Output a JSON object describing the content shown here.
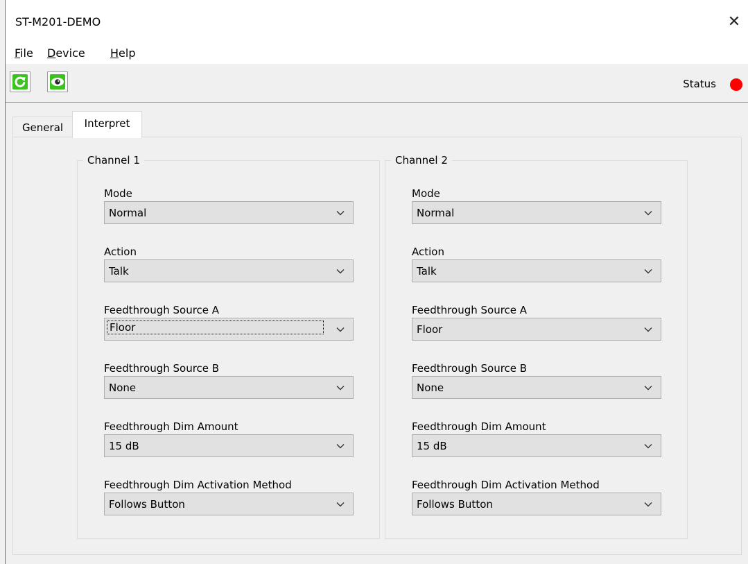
{
  "window": {
    "title": "ST-M201-DEMO",
    "close_glyph": "✕"
  },
  "menu": [
    {
      "accel": "F",
      "rest": "ile"
    },
    {
      "accel": "D",
      "rest": "evice"
    },
    {
      "accel": "H",
      "rest": "elp"
    }
  ],
  "toolbar": {
    "refresh_icon": "refresh-icon",
    "monitor_icon": "eye-icon",
    "status_label": "Status",
    "status_color": "#ff0000"
  },
  "tabs": [
    {
      "label": "General",
      "active": false
    },
    {
      "label": "Interpret",
      "active": true
    }
  ],
  "channels": [
    {
      "title": "Channel 1",
      "fields": [
        {
          "label": "Mode",
          "value": "Normal"
        },
        {
          "label": "Action",
          "value": "Talk"
        },
        {
          "label": "Feedthrough Source A",
          "value": "Floor"
        },
        {
          "label": "Feedthrough Source B",
          "value": "None"
        },
        {
          "label": "Feedthrough Dim Amount",
          "value": "15 dB"
        },
        {
          "label": "Feedthrough Dim Activation Method",
          "value": "Follows Button"
        }
      ]
    },
    {
      "title": "Channel 2",
      "fields": [
        {
          "label": "Mode",
          "value": "Normal"
        },
        {
          "label": "Action",
          "value": "Talk"
        },
        {
          "label": "Feedthrough Source A",
          "value": "Floor"
        },
        {
          "label": "Feedthrough Source B",
          "value": "None"
        },
        {
          "label": "Feedthrough Dim Amount",
          "value": "15 dB"
        },
        {
          "label": "Feedthrough Dim Activation Method",
          "value": "Follows Button"
        }
      ]
    }
  ],
  "colors": {
    "accent_green": "#3cc21e",
    "status_red": "#ff0000"
  }
}
